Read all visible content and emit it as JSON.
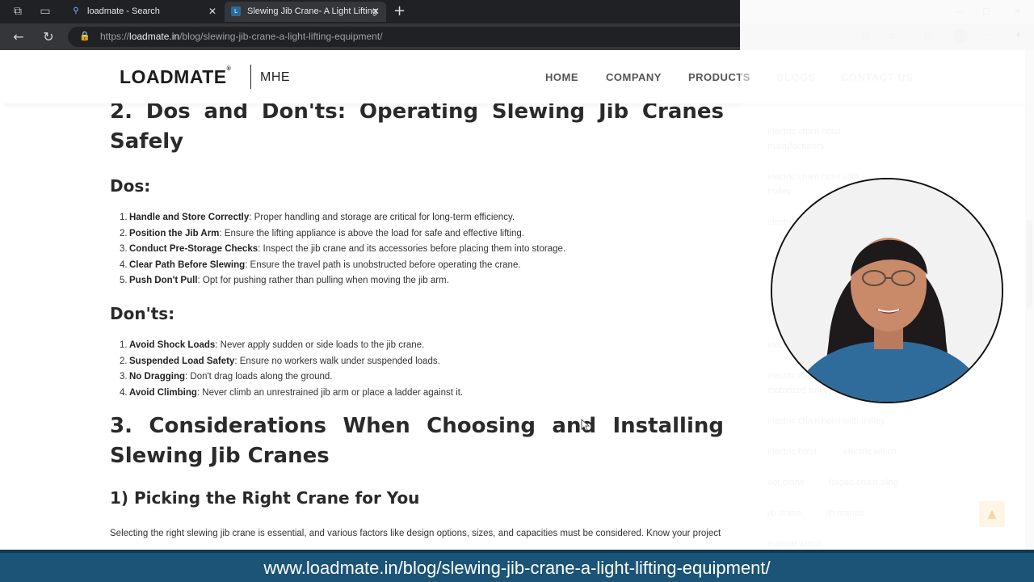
{
  "browser": {
    "tabs": [
      {
        "title": "loadmate - Search",
        "favicon": "search-icon"
      },
      {
        "title": "Slewing Jib Crane- A Light Lifting",
        "favicon": "loadmate-favicon"
      }
    ],
    "url_prefix": "https://",
    "url_domain": "loadmate.in",
    "url_path": "/blog/slewing-jib-crane-a-light-lifting-equipment/"
  },
  "site": {
    "logo": "LOADMATE",
    "logo_mark": "®",
    "logo_sub": "MHE",
    "menu": [
      "HOME",
      "COMPANY",
      "PRODUCTS",
      "BLOGS",
      "CONTACT US"
    ]
  },
  "article": {
    "section2_title": "2. Dos and Don'ts: Operating Slewing Jib Cranes Safely",
    "dos_heading": "Dos:",
    "dos": [
      {
        "num": "1.",
        "bold": "Handle and Store Correctly",
        "text": ": Proper handling and storage are critical for long-term efficiency."
      },
      {
        "num": "2.",
        "bold": "Position the Jib Arm",
        "text": ": Ensure the lifting appliance is above the load for safe and effective lifting."
      },
      {
        "num": "3.",
        "bold": "Conduct Pre-Storage Checks",
        "text": ": Inspect the jib crane and its accessories before placing them into storage."
      },
      {
        "num": "4.",
        "bold": "Clear Path Before Slewing",
        "text": ": Ensure the travel path is unobstructed before operating the crane."
      },
      {
        "num": "5.",
        "bold": "Push Don't Pull",
        "text": ": Opt for pushing rather than pulling when moving the jib arm."
      }
    ],
    "donts_heading": "Don'ts:",
    "donts": [
      {
        "num": "1.",
        "bold": "Avoid Shock Loads",
        "text": ": Never apply sudden or side loads to the jib crane."
      },
      {
        "num": "2.",
        "bold": "Suspended Load Safety",
        "text": ": Ensure no workers walk under suspended loads."
      },
      {
        "num": "3.",
        "bold": "No Dragging",
        "text": ": Don't drag loads along the ground."
      },
      {
        "num": "4.",
        "bold": "Avoid Climbing",
        "text": ": Never climb an unrestrained jib arm or place a ladder against it."
      }
    ],
    "section3_title": "3. Considerations When Choosing and Installing Slewing Jib Cranes",
    "subsection_title": "1) Picking the Right Crane for You",
    "paragraph": "Selecting the right slewing jib crane is essential, and various factors like design options, sizes, and capacities must be considered. Know your project"
  },
  "sidebar": {
    "tags": [
      "electric chain hoist manufacturers",
      "electric chain hoist with trolley",
      "electric",
      "electric",
      "electric chain hoist motorized trolley",
      "electric chain hoist with trolley",
      "electric hoist",
      "electric winch",
      "eot crane",
      "forged chain sling",
      "jib crane",
      "jib cranes",
      "manual winch"
    ]
  },
  "caption": "www.loadmate.in/blog/slewing-jib-crane-a-light-lifting-equipment/"
}
